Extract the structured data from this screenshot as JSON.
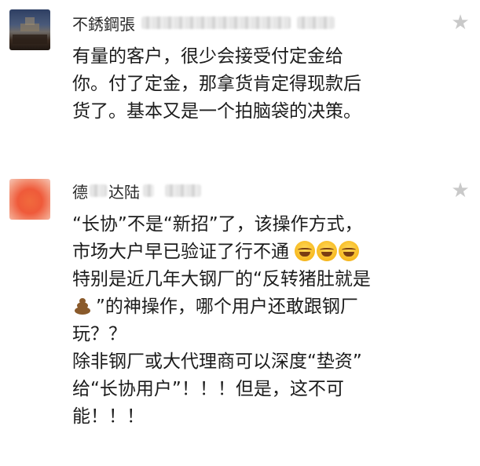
{
  "comments": [
    {
      "name": "不銹鋼張",
      "text_lines": [
        "有量的客户，很少会接受付定金给",
        "你。付了定金，那拿货肯定得现款后",
        "货了。基本又是一个拍脑袋的决策。"
      ],
      "icon_star": "star-icon"
    },
    {
      "name_prefix": "德",
      "name_mid": "达陆",
      "text_lines": [
        "“长协”不是“新招”了，该操作方式，",
        "市场大户早已验证了行不通",
        "特别是近几年大钢厂的“反转猪肚就是",
        "”的神操作，哪个用户还敢跟钢厂",
        "玩？？",
        "除非钢厂或大代理商可以深度“垫资”",
        "给“长协用户”！！！但是，这不可",
        "能！！！"
      ],
      "icon_star": "star-icon",
      "emoji_laugh": "laughing-tears-emoji",
      "emoji_poop": "poop-emoji"
    }
  ],
  "colors": {
    "text": "#1c1c1c",
    "star": "#c9c9c9",
    "background": "#ffffff"
  }
}
